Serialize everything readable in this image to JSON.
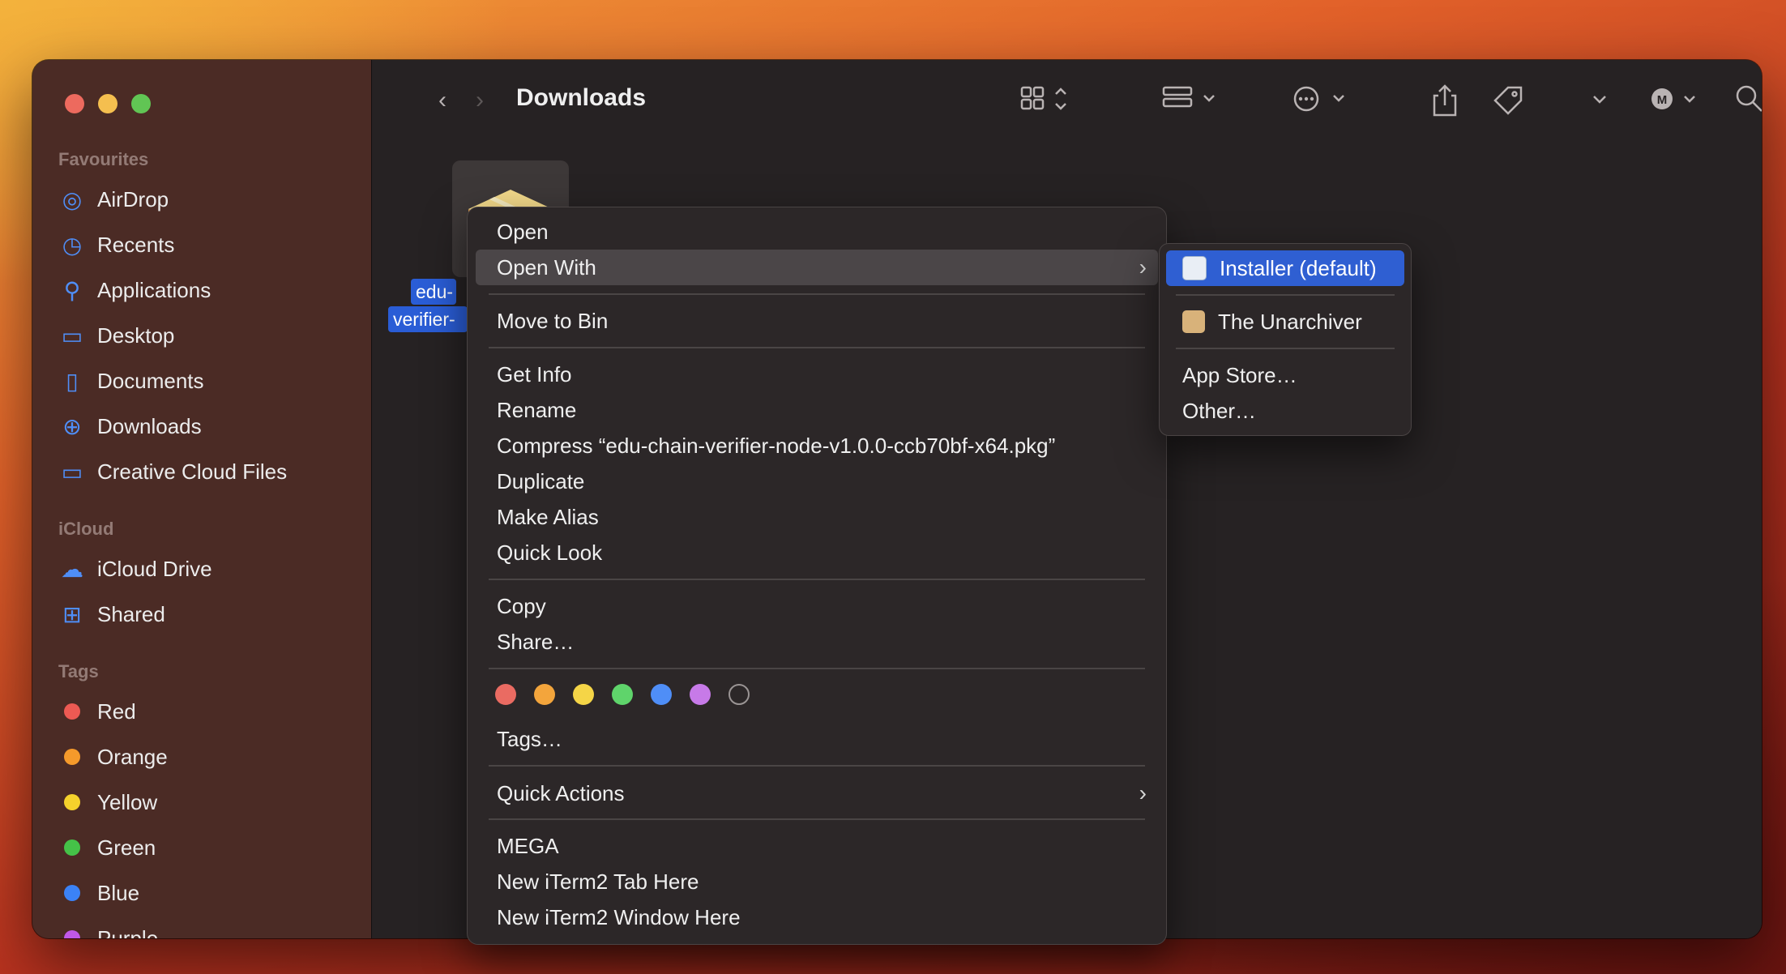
{
  "window": {
    "title": "Downloads"
  },
  "sidebar": {
    "favourites_label": "Favourites",
    "favourites": [
      {
        "label": "AirDrop",
        "icon": "airdrop-icon"
      },
      {
        "label": "Recents",
        "icon": "clock-icon"
      },
      {
        "label": "Applications",
        "icon": "applications-icon"
      },
      {
        "label": "Desktop",
        "icon": "desktop-icon"
      },
      {
        "label": "Documents",
        "icon": "document-icon"
      },
      {
        "label": "Downloads",
        "icon": "download-icon"
      },
      {
        "label": "Creative Cloud Files",
        "icon": "folder-icon"
      }
    ],
    "icloud_label": "iCloud",
    "icloud": [
      {
        "label": "iCloud Drive",
        "icon": "cloud-icon"
      },
      {
        "label": "Shared",
        "icon": "shared-folder-icon"
      }
    ],
    "tags_label": "Tags",
    "tags": [
      {
        "label": "Red",
        "color": "#ed5a53"
      },
      {
        "label": "Orange",
        "color": "#f59a2b"
      },
      {
        "label": "Yellow",
        "color": "#f5d22c"
      },
      {
        "label": "Green",
        "color": "#45c248"
      },
      {
        "label": "Blue",
        "color": "#3b82f6"
      },
      {
        "label": "Purple",
        "color": "#c158e8"
      }
    ]
  },
  "file": {
    "label_line1": "edu-",
    "label_line2": "verifier-"
  },
  "context_menu": {
    "open": "Open",
    "open_with": "Open With",
    "move_to_bin": "Move to Bin",
    "get_info": "Get Info",
    "rename": "Rename",
    "compress": "Compress “edu-chain-verifier-node-v1.0.0-ccb70bf-x64.pkg”",
    "duplicate": "Duplicate",
    "make_alias": "Make Alias",
    "quick_look": "Quick Look",
    "copy": "Copy",
    "share": "Share…",
    "tag_colors": [
      "#ea6b62",
      "#f3a53c",
      "#f5d547",
      "#5fd46b",
      "#4f8ef7",
      "#c77ae8",
      "none"
    ],
    "tags": "Tags…",
    "quick_actions": "Quick Actions",
    "mega": "MEGA",
    "iterm_tab": "New iTerm2 Tab Here",
    "iterm_window": "New iTerm2 Window Here"
  },
  "open_with_submenu": {
    "installer": "Installer (default)",
    "unarchiver": "The Unarchiver",
    "app_store": "App Store…",
    "other": "Other…"
  }
}
